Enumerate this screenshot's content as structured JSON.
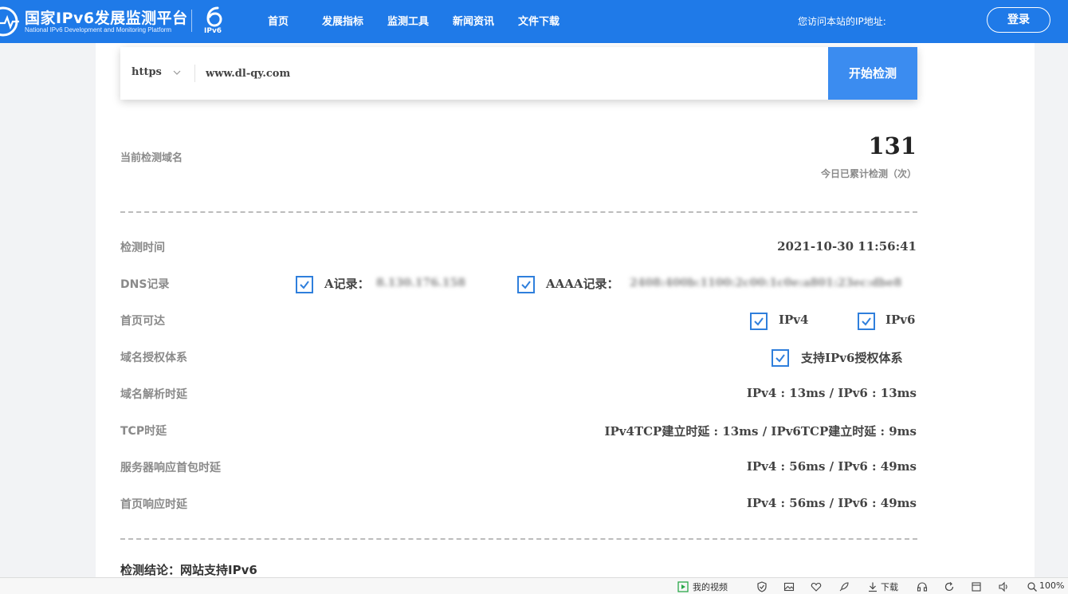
{
  "header": {
    "logo_title": "国家IPv6发展监测平台",
    "logo_subtitle": "National IPv6 Development and Monitoring Platform",
    "ipv6_badge": "IPv6",
    "nav": [
      "首页",
      "发展指标",
      "监测工具",
      "新闻资讯",
      "文件下载"
    ],
    "visitor_ip_label": "您访问本站的IP地址:",
    "login_label": "登录"
  },
  "search": {
    "protocol": "https",
    "url_value": "www.dl-qy.com",
    "button_label": "开始检测"
  },
  "summary": {
    "domain_label": "当前检测域名",
    "count": "131",
    "count_label": "今日已累计检测（次）"
  },
  "rows": {
    "check_time": {
      "label": "检测时间",
      "value": "2021-10-30 11:56:41"
    },
    "dns": {
      "label": "DNS记录",
      "a_label": "A记录：",
      "a_value": "8.130.176.158",
      "aaaa_label": "AAAA记录：",
      "aaaa_value": "2408:400b:1100:2c00:1c0e:a801:23ec:dbe8"
    },
    "homepage": {
      "label": "首页可达",
      "ipv4": "IPv4",
      "ipv6": "IPv6"
    },
    "auth": {
      "label": "域名授权体系",
      "value": "支持IPv6授权体系"
    },
    "dns_latency": {
      "label": "域名解析时延",
      "value": "IPv4 : 13ms / IPv6 : 13ms"
    },
    "tcp": {
      "label": "TCP时延",
      "value": "IPv4TCP建立时延 : 13ms / IPv6TCP建立时延 : 9ms"
    },
    "first_packet": {
      "label": "服务器响应首包时延",
      "value": "IPv4 : 56ms / IPv6 : 49ms"
    },
    "homepage_response": {
      "label": "首页响应时延",
      "value": "IPv4 : 56ms / IPv6 : 49ms"
    }
  },
  "conclusion": "检测结论：网站支持IPv6",
  "statusbar": {
    "my_video": "我的视频",
    "download": "下载",
    "zoom": "100%"
  },
  "colors": {
    "primary": "#1f7ae8",
    "button": "#3b8cf0",
    "checkbox": "#2f7fdc"
  },
  "icons": [
    "pulse-logo-icon",
    "ipv6-logo-icon",
    "chevron-down-icon",
    "check-icon",
    "play-icon",
    "shield-icon",
    "image-icon",
    "heart-icon",
    "rocket-icon",
    "download-icon",
    "headset-icon",
    "refresh-icon",
    "window-icon",
    "speaker-icon",
    "zoom-icon"
  ]
}
